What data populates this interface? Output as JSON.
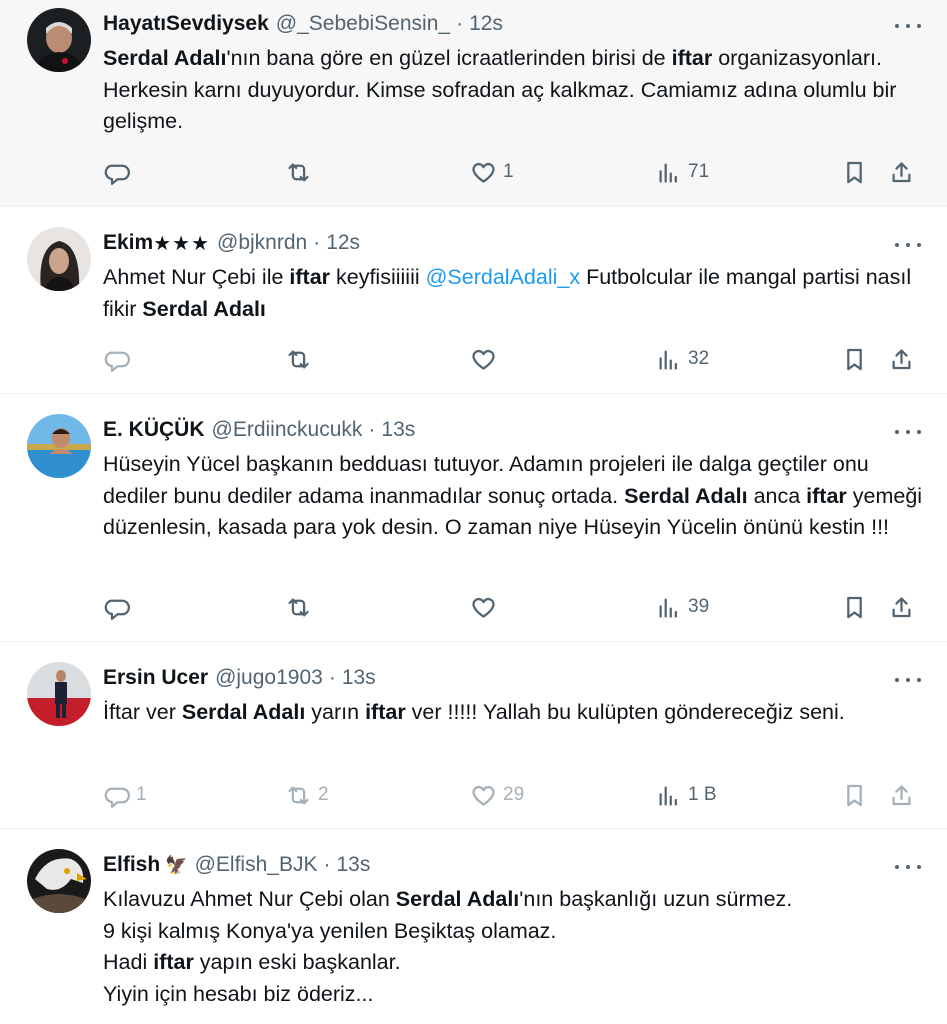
{
  "tweets": [
    {
      "name": "HayatıSevdiysek",
      "handle": "@_SebebiSensin_",
      "time": "12s",
      "text_parts": [
        {
          "b": "Serdal Adalı"
        },
        {
          "t": "'nın bana göre en güzel icraatlerinden birisi de "
        },
        {
          "b": "iftar"
        },
        {
          "t": " organizasyonları. Herkesin karnı duyuyordur. Kimse sofradan aç kalkmaz. Camiamız adına olumlu bir gelişme."
        }
      ],
      "replies": "",
      "retweets": "",
      "likes": "1",
      "views": "71"
    },
    {
      "name": "Ekim",
      "name_suffix": "★★★",
      "handle": "@bjknrdn",
      "time": "12s",
      "text_parts": [
        {
          "t": "Ahmet Nur Çebi ile "
        },
        {
          "b": "iftar"
        },
        {
          "t": " keyfisiiiiii "
        },
        {
          "m": "@SerdalAdali_x"
        },
        {
          "t": " Futbolcular ile mangal partisi nasıl fikir "
        },
        {
          "b": "Serdal Adalı"
        }
      ],
      "replies": "",
      "retweets": "",
      "likes": "",
      "views": "32"
    },
    {
      "name": "E. KÜÇÜK",
      "handle": "@Erdiinckucukk",
      "time": "13s",
      "text_parts": [
        {
          "t": "Hüseyin Yücel başkanın bedduası tutuyor. Adamın projeleri ile dalga geçtiler onu dediler bunu dediler adama inanmadılar sonuç ortada. "
        },
        {
          "b": "Serdal Adalı"
        },
        {
          "t": " anca "
        },
        {
          "b": "iftar"
        },
        {
          "t": " yemeği düzenlesin, kasada para yok desin. O zaman niye Hüseyin Yücelin önünü kestin !!!"
        }
      ],
      "replies": "",
      "retweets": "",
      "likes": "",
      "views": "39"
    },
    {
      "name": "Ersin Ucer",
      "handle": "@jugo1903",
      "time": "13s",
      "text_parts": [
        {
          "t": "İftar ver "
        },
        {
          "b": "Serdal Adalı"
        },
        {
          "t": " yarın "
        },
        {
          "b": "iftar"
        },
        {
          "t": " ver !!!!! Yallah bu kulüpten göndereceğiz seni."
        }
      ],
      "replies": "1",
      "retweets": "2",
      "likes": "29",
      "views": "1 B"
    },
    {
      "name": "Elfish",
      "name_suffix": "🦅",
      "handle": "@Elfish_BJK",
      "time": "13s",
      "text_parts": [
        {
          "t": "Kılavuzu Ahmet Nur Çebi olan "
        },
        {
          "b": "Serdal Adalı"
        },
        {
          "t": "'nın başkanlığı uzun sürmez.\n9 kişi kalmış Konya'ya yenilen Beşiktaş olamaz.\nHadi "
        },
        {
          "b": "iftar"
        },
        {
          "t": " yapın eski başkanlar.\nYiyin için hesabı biz öderiz..."
        }
      ],
      "replies": "",
      "retweets": "",
      "likes": "",
      "views": ""
    }
  ],
  "icons": {
    "reply": "reply-icon",
    "retweet": "retweet-icon",
    "like": "heart-icon",
    "views": "views-icon",
    "bookmark": "bookmark-icon",
    "share": "share-icon",
    "more": "more-icon"
  },
  "colors": {
    "text": "#0f1419",
    "secondary": "#536471",
    "link": "#1d9bf0",
    "highlight_bg": "#f7f7f7"
  }
}
